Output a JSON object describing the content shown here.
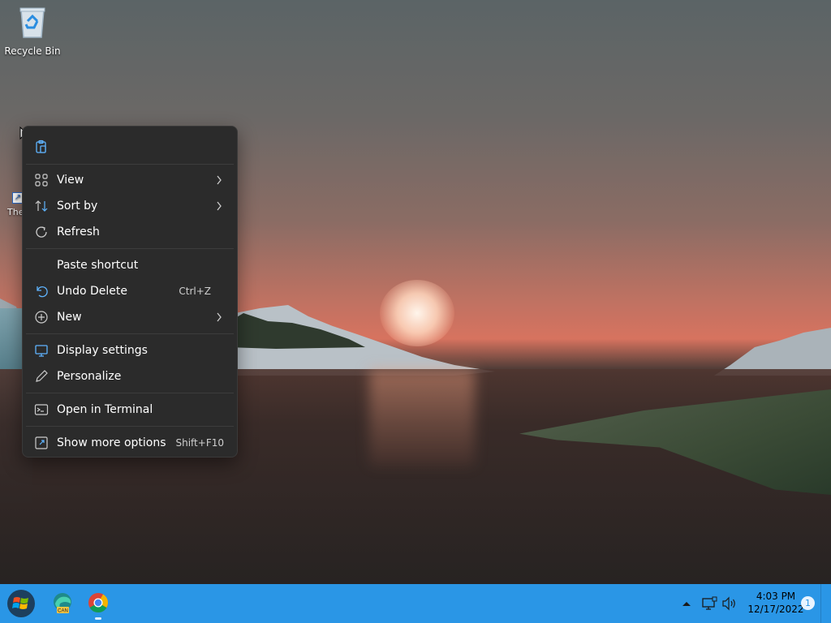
{
  "desktop": {
    "icons": [
      {
        "label": "Recycle Bin",
        "icon": "recycle-bin-icon"
      },
      {
        "label": "The",
        "icon": "shortcut-icon"
      }
    ]
  },
  "context_menu": {
    "top_icon": "clipboard-icon",
    "items": [
      {
        "label": "View",
        "icon": "grid-icon",
        "has_submenu": true
      },
      {
        "label": "Sort by",
        "icon": "sort-icon",
        "has_submenu": true
      },
      {
        "label": "Refresh",
        "icon": "refresh-icon",
        "has_submenu": false
      },
      {
        "label": "Paste shortcut",
        "icon": "",
        "has_submenu": false
      },
      {
        "label": "Undo Delete",
        "icon": "undo-icon",
        "shortcut": "Ctrl+Z"
      },
      {
        "label": "New",
        "icon": "plus-circle-icon",
        "has_submenu": true
      },
      {
        "label": "Display settings",
        "icon": "display-icon"
      },
      {
        "label": "Personalize",
        "icon": "pen-icon"
      },
      {
        "label": "Open in Terminal",
        "icon": "terminal-icon"
      },
      {
        "label": "Show more options",
        "icon": "more-options-icon",
        "shortcut": "Shift+F10"
      }
    ]
  },
  "taskbar": {
    "apps": [
      {
        "name": "Microsoft Edge Canary",
        "icon": "edge-icon",
        "badge": "CAN"
      },
      {
        "name": "Google Chrome",
        "icon": "chrome-icon"
      }
    ],
    "tray": {
      "icons": [
        "chevron-up-icon",
        "network-icon",
        "volume-icon"
      ],
      "time": "4:03 PM",
      "date": "12/17/2022",
      "notification_count": "1"
    }
  },
  "colors": {
    "taskbar": "#2a96e6",
    "menu_bg": "#2b2b2b",
    "menu_text": "#ffffff",
    "icon_accent": "#5fb4ff"
  }
}
